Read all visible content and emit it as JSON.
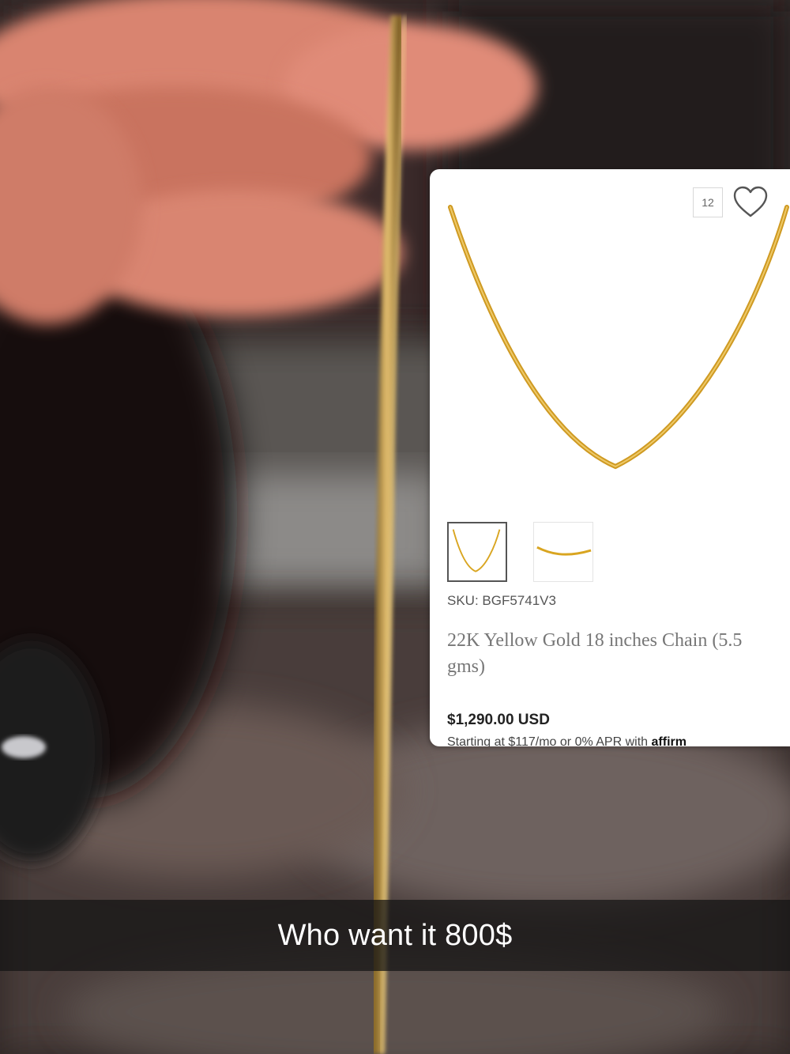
{
  "photo": {
    "description_icon": "hand-holding-chain-photo"
  },
  "product_card": {
    "image_count": "12",
    "wishlist_icon": "heart-icon",
    "sku": "SKU: BGF5741V3",
    "title": "22K Yellow Gold 18 inches Chain (5.5 gms)",
    "price": "$1,290.00 USD",
    "financing_text": "Starting at $117/mo or 0% APR with",
    "financing_brand": "affirm"
  },
  "caption": {
    "text": "Who want it 800$"
  },
  "colors": {
    "gold": "#d9a520",
    "caption_bg": "#141414",
    "card_bg": "#ffffff"
  }
}
